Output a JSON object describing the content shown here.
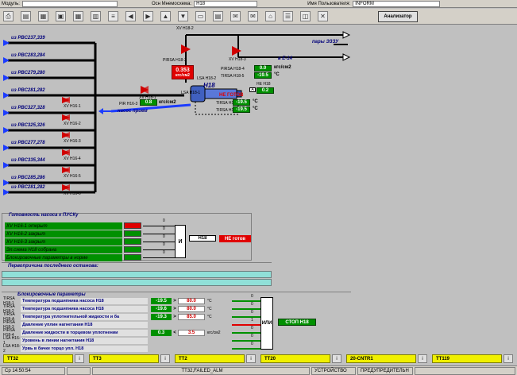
{
  "topbar": {
    "module_label": "Модуль:",
    "mnemo_label": "Осн Мнемосхема: ",
    "mnemo_value": "Н18",
    "user_label": "Имя Пользователя: ",
    "user_value": "INFORM"
  },
  "toolbar": {
    "analyzer_label": "Анализатор",
    "icons": [
      "printer-icon",
      "folder-icon",
      "table-icon",
      "save-icon",
      "grid-icon",
      "chart-icon",
      "list-icon",
      "arrow-left-icon",
      "arrow-right-icon",
      "arrow-up-icon",
      "arrow-down-icon",
      "window-icon",
      "report-icon",
      "email-icon",
      "mail-icon",
      "home-icon",
      "tree-icon",
      "diagram-icon",
      "close-icon"
    ]
  },
  "pipes": {
    "left_sources": [
      "из РВС237,339",
      "из РВС283,284",
      "из РВС279,280",
      "из РВС281,282",
      "из РВС327,328",
      "из РВС325,326",
      "из РВС277,278",
      "из РВС335,344",
      "из РВС285,286",
      "из РВС281,282"
    ],
    "valves_left": [
      "XV Н16-1",
      "XV Н16-2",
      "XV Н16-3",
      "XV Н16-4",
      "XV Н16-5",
      "XV Н16-6"
    ],
    "to_ezu": "пары ЭЗЗУ",
    "to_e14": "в Е-14",
    "header_valve_top": "XV Н18-2",
    "header_valve_e14": "XV Н18-3",
    "main_valve": "XV Н18-1",
    "suction": "насос прием"
  },
  "pump": {
    "name": "Н18",
    "pressure_tag": "PIRSA Н18-3",
    "pressure_value": "0.353",
    "pressure_unit": "кгс/см2",
    "level_tag": "LSA Н18-2",
    "level_tag2": "LSA Н18-1",
    "not_ready": "НЕ ГОТОВ",
    "current_tag": "НЕ Н18",
    "current_unit": "А",
    "current_value": "0.2",
    "discharge_tag": "PIRSA Н18-4",
    "discharge_value": "0.0",
    "discharge_unit": "кгс/см2",
    "temp_tag": "TIRSA Н18-5",
    "temp_value": "-19.5",
    "temp_unit": "°С",
    "bearing1_tag": "TIRSA Н18-1",
    "bearing1_value": "-19.5",
    "bearing1_unit": "°С",
    "bearing2_tag": "TIRSA Н18-2",
    "bearing2_value": "-19.5",
    "bearing2_unit": "°С",
    "suction_tag": "PIR Н16-3",
    "suction_value": "0.8",
    "suction_unit": "кгс/см2"
  },
  "ready": {
    "title": "Готовность насоса к ПУСКу",
    "rows": [
      {
        "label": "XV Н16-1 открыт",
        "color": "#e00000"
      },
      {
        "label": "XV Н16-2 закрыт",
        "color": "#009000"
      },
      {
        "label": "XV Н16-3 закрыт",
        "color": "#009000"
      },
      {
        "label": "Эл.схема Н18 собрана",
        "color": "#009000"
      },
      {
        "label": "Блокировочные параметры в норме",
        "color": "#009000"
      }
    ],
    "zero": "0",
    "and_label": "И",
    "pump_label": "Н18",
    "status": "НЕ готов"
  },
  "diag": {
    "title": "Первопричина последнего останова:"
  },
  "blocks": {
    "title": "Блокировочные параметры",
    "rows": [
      {
        "tag": "TIRSA Н18-1",
        "desc": "Температура подшипника насоса Н18",
        "value": "-19.5",
        "sign": ">",
        "set": "80.0",
        "unit": "°С",
        "out": "0"
      },
      {
        "tag": "TIRSA Н18-2",
        "desc": "Температура подшипника насоса Н18",
        "value": "-19.6",
        "sign": ">",
        "set": "80.0",
        "unit": "°С",
        "out": "0"
      },
      {
        "tag": "TIRSA Н18-А",
        "desc": "Температура уплотнительной жидкости и ба",
        "value": "-19.3",
        "sign": ">",
        "set": "85.0",
        "unit": "°С",
        "out": "0"
      },
      {
        "tag": "PIRSA Н18-3",
        "desc": "Давление уплин нагнетания Н18",
        "value": "",
        "sign": "",
        "set": "",
        "unit": "",
        "out": "1"
      },
      {
        "tag": "PIRSA Н18-4",
        "desc": "Давление жидкости в торцевом уплотнении",
        "value": "0.3",
        "sign": "<",
        "set": "3.5",
        "unit": "кгс/см2",
        "out": "0"
      },
      {
        "tag": "LSA Н16-1",
        "desc": "Уровень в линии нагнетания Н18",
        "value": "",
        "sign": "",
        "set": "",
        "unit": "",
        "out": "0"
      },
      {
        "tag": "LSA Н18-2",
        "desc": "Урвь в бачке торцо упл. Н18",
        "value": "",
        "sign": "",
        "set": "",
        "unit": "",
        "out": "0"
      }
    ],
    "or_label": "ИЛИ",
    "stop_label": "СТОП Н18"
  },
  "status_tabs": [
    {
      "label": "ТТ32"
    },
    {
      "label": "ТТ3"
    },
    {
      "label": "ТТ2"
    },
    {
      "label": "ТТ20"
    },
    {
      "label": "20-CNTR1"
    },
    {
      "label": "ТТ119"
    }
  ],
  "statusbar": {
    "time": "Ср 14:50:54",
    "alarm": "ТТ32,FAILED_ALM",
    "device": "УСТРОЙСТВО",
    "level": "ПРЕДУПРЕДИТЕЛЬН"
  },
  "colors": {
    "pipe_black": "#000000",
    "pipe_blue": "#1c3cff",
    "alarm_red": "#e00000",
    "ok_green": "#009000"
  }
}
